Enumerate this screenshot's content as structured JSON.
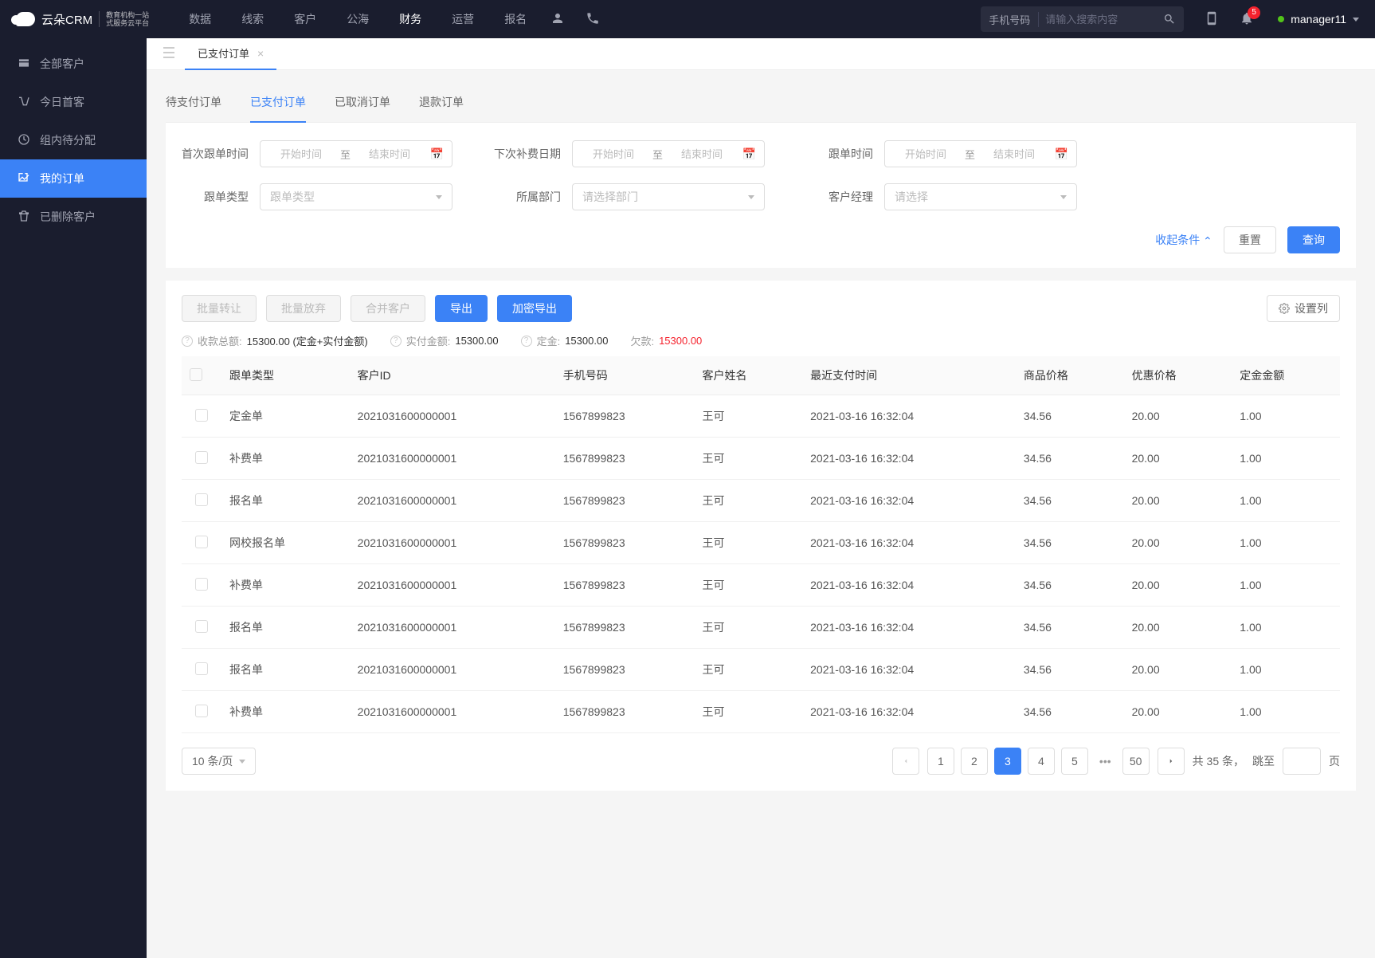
{
  "brand": {
    "name": "云朵CRM",
    "sub1": "教育机构一站",
    "sub2": "式服务云平台"
  },
  "topnav": {
    "items": [
      "数据",
      "线索",
      "客户",
      "公海",
      "财务",
      "运营",
      "报名"
    ],
    "active_index": 4,
    "search_type": "手机号码",
    "search_placeholder": "请输入搜索内容",
    "notif_count": "5",
    "username": "manager11"
  },
  "sidebar": {
    "items": [
      {
        "label": "全部客户"
      },
      {
        "label": "今日首客"
      },
      {
        "label": "组内待分配"
      },
      {
        "label": "我的订单"
      },
      {
        "label": "已删除客户"
      }
    ],
    "active_index": 3
  },
  "tabbar": {
    "tab_label": "已支付订单"
  },
  "sub_tabs": {
    "items": [
      "待支付订单",
      "已支付订单",
      "已取消订单",
      "退款订单"
    ],
    "active_index": 1
  },
  "filters": {
    "first_follow_label": "首次跟单时间",
    "next_fee_label": "下次补费日期",
    "follow_time_label": "跟单时间",
    "follow_type_label": "跟单类型",
    "dept_label": "所属部门",
    "manager_label": "客户经理",
    "start_placeholder": "开始时间",
    "end_placeholder": "结束时间",
    "to": "至",
    "follow_type_placeholder": "跟单类型",
    "dept_placeholder": "请选择部门",
    "manager_placeholder": "请选择",
    "collapse": "收起条件",
    "reset": "重置",
    "query": "查询"
  },
  "actions": {
    "bulk_transfer": "批量转让",
    "bulk_abandon": "批量放弃",
    "merge": "合并客户",
    "export": "导出",
    "encrypt_export": "加密导出",
    "col_settings": "设置列"
  },
  "summary": {
    "total_label": "收款总额:",
    "total_val": "15300.00 (定金+实付金额)",
    "paid_label": "实付金额:",
    "paid_val": "15300.00",
    "deposit_label": "定金:",
    "deposit_val": "15300.00",
    "owed_label": "欠款:",
    "owed_val": "15300.00"
  },
  "table": {
    "headers": [
      "跟单类型",
      "客户ID",
      "手机号码",
      "客户姓名",
      "最近支付时间",
      "商品价格",
      "优惠价格",
      "定金金额"
    ],
    "rows": [
      [
        "定金单",
        "2021031600000001",
        "1567899823",
        "王可",
        "2021-03-16 16:32:04",
        "34.56",
        "20.00",
        "1.00"
      ],
      [
        "补费单",
        "2021031600000001",
        "1567899823",
        "王可",
        "2021-03-16 16:32:04",
        "34.56",
        "20.00",
        "1.00"
      ],
      [
        "报名单",
        "2021031600000001",
        "1567899823",
        "王可",
        "2021-03-16 16:32:04",
        "34.56",
        "20.00",
        "1.00"
      ],
      [
        "网校报名单",
        "2021031600000001",
        "1567899823",
        "王可",
        "2021-03-16 16:32:04",
        "34.56",
        "20.00",
        "1.00"
      ],
      [
        "补费单",
        "2021031600000001",
        "1567899823",
        "王可",
        "2021-03-16 16:32:04",
        "34.56",
        "20.00",
        "1.00"
      ],
      [
        "报名单",
        "2021031600000001",
        "1567899823",
        "王可",
        "2021-03-16 16:32:04",
        "34.56",
        "20.00",
        "1.00"
      ],
      [
        "报名单",
        "2021031600000001",
        "1567899823",
        "王可",
        "2021-03-16 16:32:04",
        "34.56",
        "20.00",
        "1.00"
      ],
      [
        "补费单",
        "2021031600000001",
        "1567899823",
        "王可",
        "2021-03-16 16:32:04",
        "34.56",
        "20.00",
        "1.00"
      ]
    ]
  },
  "pagination": {
    "page_size": "10 条/页",
    "pages": [
      "1",
      "2",
      "3",
      "4",
      "5"
    ],
    "active_page": "3",
    "last_page": "50",
    "total_prefix": "共",
    "total_count": "35",
    "total_suffix": "条，",
    "jump_label": "跳至",
    "page_unit": "页"
  }
}
